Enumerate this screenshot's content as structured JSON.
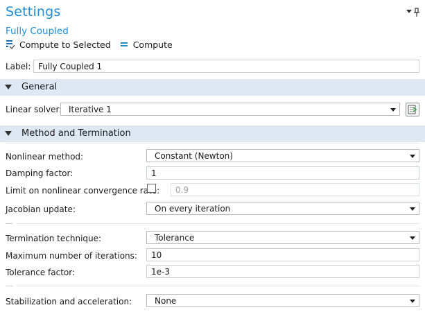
{
  "header": {
    "title": "Settings",
    "subtitle": "Fully Coupled"
  },
  "toolbar": {
    "compute_selected_label": "Compute to Selected",
    "compute_label": "Compute"
  },
  "label_field": {
    "label": "Label:",
    "value": "Fully Coupled 1"
  },
  "sections": {
    "general": "General",
    "method": "Method and Termination"
  },
  "general": {
    "linear_solver_label": "Linear solver:",
    "linear_solver_value": "Iterative 1"
  },
  "method": {
    "nonlinear_method_label": "Nonlinear method:",
    "nonlinear_method_value": "Constant (Newton)",
    "damping_label": "Damping factor:",
    "damping_value": "1",
    "limit_label": "Limit on nonlinear convergence rate:",
    "limit_checked": false,
    "limit_value": "0.9",
    "jacobian_label": "Jacobian update:",
    "jacobian_value": "On every iteration",
    "termination_label": "Termination technique:",
    "termination_value": "Tolerance",
    "max_iter_label": "Maximum number of iterations:",
    "max_iter_value": "10",
    "tolerance_label": "Tolerance factor:",
    "tolerance_value": "1e-3",
    "stabilization_label": "Stabilization and acceleration:",
    "stabilization_value": "None"
  },
  "colors": {
    "accent": "#1e8fd6",
    "section_bg": "#dde8f3"
  },
  "icons": {
    "pin": "pin-dropdown-icon",
    "compute_selected": "compute-to-selected-icon",
    "compute": "compute-icon",
    "side_button": "go-to-source-icon"
  }
}
